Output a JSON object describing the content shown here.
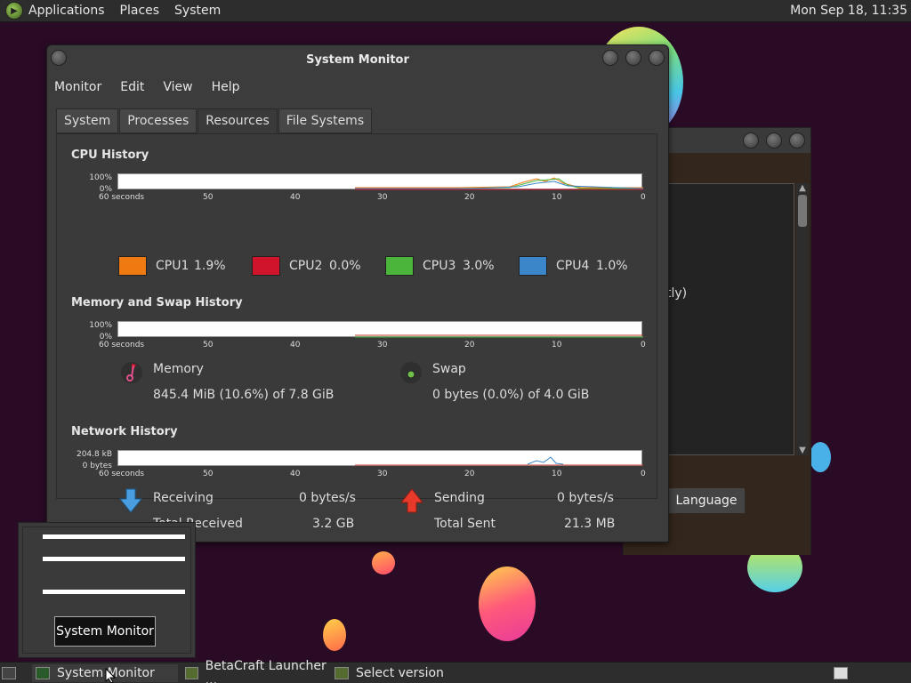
{
  "top_panel": {
    "menus": [
      "Applications",
      "Places",
      "System"
    ],
    "clock": "Mon Sep 18, 11:35"
  },
  "background_window": {
    "visible_text": "tly)",
    "language_button": "Language"
  },
  "window": {
    "title": "System Monitor",
    "menu": [
      "Monitor",
      "Edit",
      "View",
      "Help"
    ],
    "tabs": [
      "System",
      "Processes",
      "Resources",
      "File Systems"
    ],
    "active_tab": "Resources",
    "cpu": {
      "title": "CPU History",
      "ylabels": [
        "100%",
        "0%"
      ],
      "xlabels": [
        "60 seconds",
        "50",
        "40",
        "30",
        "20",
        "10",
        "0"
      ],
      "cores": [
        {
          "name": "CPU1",
          "value": "1.9%",
          "color": "#f07a12"
        },
        {
          "name": "CPU2",
          "value": "0.0%",
          "color": "#d0142c"
        },
        {
          "name": "CPU3",
          "value": "3.0%",
          "color": "#4ab53a"
        },
        {
          "name": "CPU4",
          "value": "1.0%",
          "color": "#3a86c8"
        }
      ]
    },
    "memory": {
      "title": "Memory and Swap History",
      "ylabels": [
        "100%",
        "0%"
      ],
      "xlabels": [
        "60 seconds",
        "50",
        "40",
        "30",
        "20",
        "10",
        "0"
      ],
      "memory_label": "Memory",
      "memory_value": "845.4 MiB (10.6%) of 7.8 GiB",
      "swap_label": "Swap",
      "swap_value": "0 bytes (0.0%) of 4.0 GiB"
    },
    "network": {
      "title": "Network History",
      "ylabels": [
        "204.8 kB",
        "0 bytes"
      ],
      "xlabels": [
        "60 seconds",
        "50",
        "40",
        "30",
        "20",
        "10",
        "0"
      ],
      "receiving_label": "Receiving",
      "receiving_value": "0 bytes/s",
      "total_received_label": "Total Received",
      "total_received_value": "3.2 GB",
      "sending_label": "Sending",
      "sending_value": "0 bytes/s",
      "total_sent_label": "Total Sent",
      "total_sent_value": "21.3 MB"
    }
  },
  "preview_tooltip": "System Monitor",
  "taskbar": {
    "tasks": [
      "System Monitor",
      "BetaCraft Launcher ...",
      "Select version"
    ]
  }
}
